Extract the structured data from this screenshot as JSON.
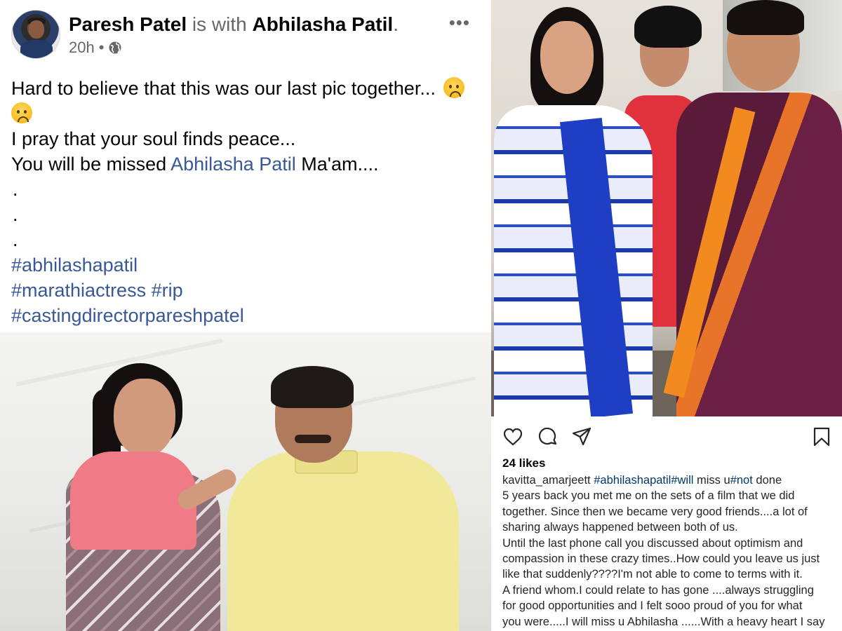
{
  "facebook": {
    "author": "Paresh Patel",
    "with_text": "is with",
    "tagged": "Abhilasha Patil",
    "period": ".",
    "time": "20h",
    "separator": "•",
    "privacy_icon": "globe-icon",
    "more_icon": "•••",
    "body": {
      "line1": "Hard to believe that this was our last pic together...",
      "line3": "I pray that your soul finds peace...",
      "line4_prefix": "You will be missed",
      "line4_link": "Abhilasha Patil",
      "line4_suffix": "Ma'am....",
      "dot1": ".",
      "dot2": ".",
      "dot3": ".",
      "hashtag1": "#abhilashapatil",
      "hashtag2": "#marathiactress",
      "hashtag3": "#rip",
      "hashtag4": "#castingdirectorpareshpatel"
    },
    "emoji_name": "sad-face-emoji"
  },
  "instagram": {
    "likes": "24 likes",
    "username": "kavitta_amarjeett",
    "caption_tags": "#abhilashapatil#will",
    "caption_after_tags1": " miss u",
    "caption_tag2": "#not",
    "caption_after_tags2": " done",
    "lines": [
      "5 years back you met me on the sets of a film that we did",
      "together. Since then we became very good friends....a lot of",
      "sharing always happened between both of us.",
      "Until the last phone call you discussed about optimism and",
      "compassion in these crazy times..How could you leave us just",
      "like that suddenly????I'm not able to come to terms with it.",
      "A friend whom.I could relate to has gone ....always struggling",
      "for good opportunities and I felt sooo proud of you for what",
      "you were.....I will miss u Abhilasha ......With a heavy heart I say"
    ],
    "icons": [
      "heart-icon",
      "comment-icon",
      "share-icon",
      "bookmark-icon"
    ]
  }
}
